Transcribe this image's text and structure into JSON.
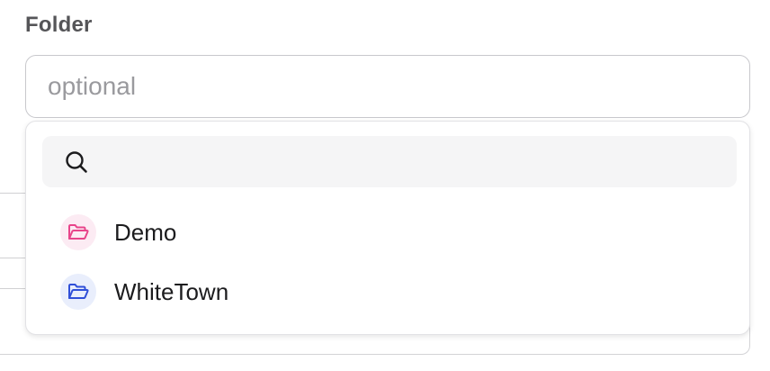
{
  "folder_field": {
    "label": "Folder",
    "placeholder": "optional",
    "value": ""
  },
  "dropdown": {
    "search": {
      "icon": "search-icon",
      "value": ""
    },
    "options": [
      {
        "label": "Demo",
        "icon": "folder-open-icon",
        "color": "#e8458b",
        "badge_bg": "#fcebf3"
      },
      {
        "label": "WhiteTown",
        "icon": "folder-open-icon",
        "color": "#2f4fd8",
        "badge_bg": "#e9eefc"
      }
    ]
  }
}
